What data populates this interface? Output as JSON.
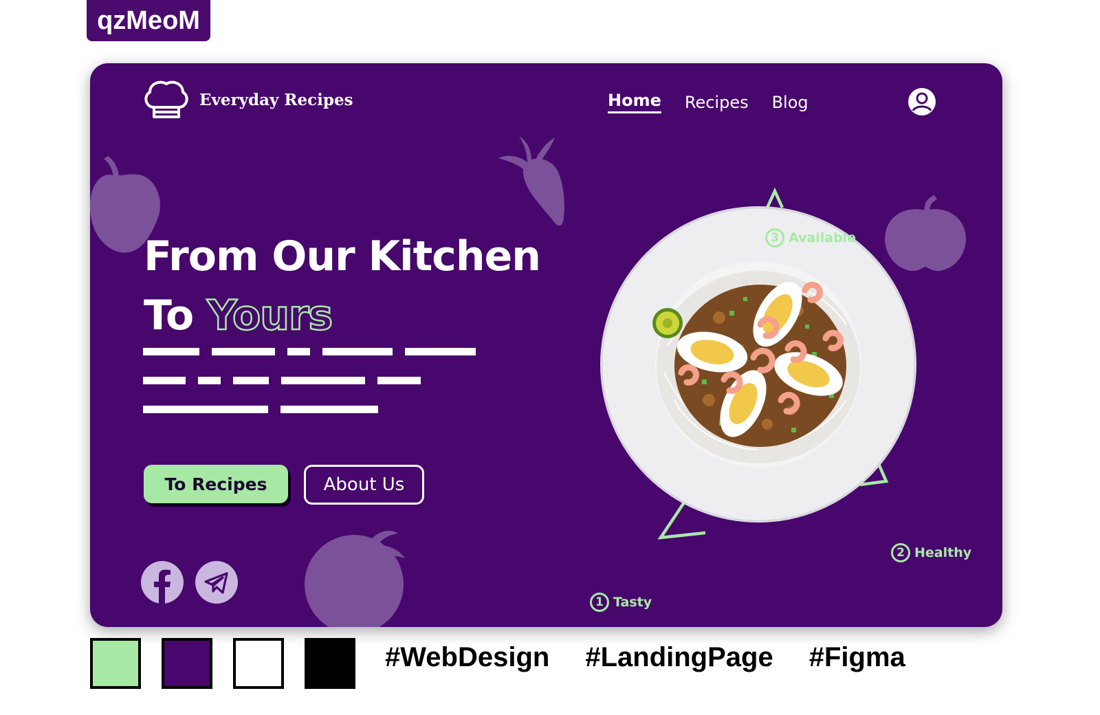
{
  "watermark": "qzMeoM",
  "brand": {
    "name": "Everyday Recipes",
    "logo_icon": "chef-hat-icon"
  },
  "nav": {
    "items": [
      {
        "label": "Home",
        "active": true
      },
      {
        "label": "Recipes",
        "active": false
      },
      {
        "label": "Blog",
        "active": false
      }
    ],
    "user_icon": "user-circle-icon"
  },
  "hero": {
    "title_line1": "From Our Kitchen",
    "title_line2_plain": "To",
    "title_line2_outline": "Yours"
  },
  "buttons": {
    "primary": "To Recipes",
    "secondary": "About Us"
  },
  "social": [
    "facebook-icon",
    "telegram-icon"
  ],
  "features": [
    {
      "number": "1",
      "label": "Tasty"
    },
    {
      "number": "2",
      "label": "Healthy"
    },
    {
      "number": "3",
      "label": "Available"
    }
  ],
  "palette": [
    "#a7e9a4",
    "#48076c",
    "#ffffff",
    "#000000"
  ],
  "hashtags": [
    "#WebDesign",
    "#LandingPage",
    "#Figma"
  ]
}
